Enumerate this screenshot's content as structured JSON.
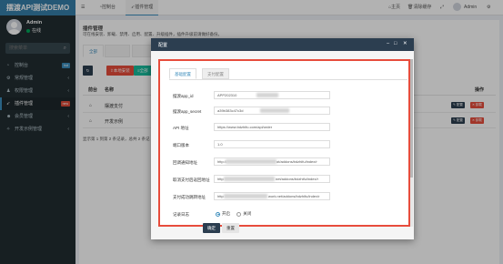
{
  "sidebar": {
    "brand": "摆渡API测试DEMO",
    "user": {
      "name": "Admin",
      "status": "在线"
    },
    "search_placeholder": "搜索菜单",
    "items": [
      {
        "label": "控制台",
        "badge": "hot",
        "icon": "dashboard-icon"
      },
      {
        "label": "常规管理",
        "icon": "gear-icon"
      },
      {
        "label": "权限管理",
        "icon": "users-icon"
      },
      {
        "label": "插件管理",
        "badge": "new",
        "icon": "rocket-icon"
      },
      {
        "label": "会员管理",
        "icon": "user-icon"
      },
      {
        "label": "开发示例管理",
        "icon": "magic-icon"
      }
    ]
  },
  "navbar": {
    "tabs": [
      {
        "label": "控制台",
        "icon": "dashboard-icon"
      },
      {
        "label": "插件管理",
        "icon": "rocket-icon"
      }
    ],
    "home": "主页",
    "clear_cache": "清除缓存",
    "user": "Admin"
  },
  "page": {
    "title": "插件管理",
    "desc": "可在线安装、卸载、禁用、启用、配置、升级插件，插件升级前请做好备份。",
    "tabs": [
      "全部",
      "",
      ""
    ],
    "toolbar": {
      "local_install": "本地安装",
      "all": "全部"
    },
    "columns": {
      "preview": "前台",
      "name": "名称",
      "actions": "操作"
    },
    "rows": [
      {
        "name": "摆渡支付",
        "config": "配置",
        "uninstall": "卸载"
      },
      {
        "name": "开发示例",
        "config": "配置",
        "uninstall": "卸载"
      }
    ],
    "pagination": "显示第 1 到第 2 条记录，总共 2 条记"
  },
  "modal": {
    "title": "配置",
    "tabs": [
      "基础配置",
      "支付配置"
    ],
    "fields": [
      {
        "label": "摆渡app_id",
        "value": "APP202310"
      },
      {
        "label": "摆渡app_secret",
        "value": "a39b383c47c3d"
      },
      {
        "label": "API 地址",
        "value": "https://www.bdzhifu.com/api/order"
      },
      {
        "label": "端口版本",
        "value": "1.0"
      },
      {
        "label": "回调通知地址",
        "value": "http://"
      },
      {
        "label": "取消支付后返回地址",
        "value": "http"
      },
      {
        "label": "支付成功跳转地址",
        "value": "http"
      }
    ],
    "field_suffixes": [
      "",
      "",
      "",
      "",
      "ot/addons/bdzhifu/index/r",
      "net/addons/bdzhifu/index/r",
      "work.net/addons/bdzhifu/index/r"
    ],
    "log": {
      "label": "记录日志",
      "on": "开启",
      "off": "关闭"
    },
    "ok": "确定",
    "reset": "重置"
  }
}
